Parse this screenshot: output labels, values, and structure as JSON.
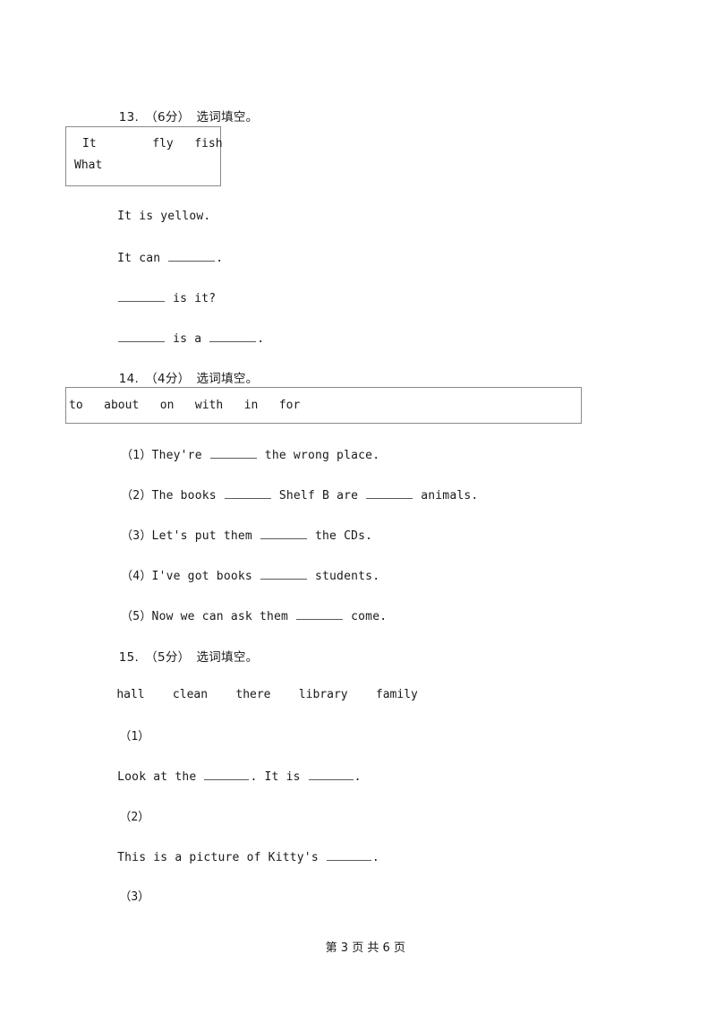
{
  "document": {
    "type": "worksheet",
    "background_color": "#ffffff",
    "text_color": "#1a1a1a",
    "border_color": "#8a8a8a"
  },
  "questions": [
    {
      "number": "13.",
      "points": "（6分）",
      "instruction": "选词填空。",
      "heading": "13.　（6分）　选词填空。",
      "wordbank": {
        "bordered": true,
        "line1": "It        fly   fish",
        "line2": "What"
      },
      "lines": [
        {
          "prefix": "It is yellow.",
          "mid": "",
          "suffix": "",
          "blanks": 0
        },
        {
          "prefix": "It can ",
          "mid": "",
          "suffix": ".",
          "blanks": 1
        },
        {
          "prefix": "",
          "mid": " is it?",
          "suffix": "",
          "blanks": 1
        },
        {
          "prefix": "",
          "mid": " is a ",
          "suffix": ".",
          "blanks": 2
        }
      ]
    },
    {
      "number": "14.",
      "points": "（4分）",
      "instruction": "选词填空。",
      "heading": "14.　（4分）　选词填空。",
      "wordbank": {
        "bordered": true,
        "line1": "to   about   on   with   in   for"
      },
      "items": [
        {
          "label": "（1）",
          "prefix": "They're ",
          "mid": " the wrong place.",
          "suffix": ""
        },
        {
          "label": "（2）",
          "prefix": "The books ",
          "mid": " Shelf B are ",
          "suffix": " animals."
        },
        {
          "label": "（3）",
          "prefix": "Let's put them ",
          "mid": " the CDs.",
          "suffix": ""
        },
        {
          "label": "（4）",
          "prefix": "I've got books ",
          "mid": " students.",
          "suffix": ""
        },
        {
          "label": "（5）",
          "prefix": "Now we can ask them ",
          "mid": " come.",
          "suffix": ""
        }
      ]
    },
    {
      "number": "15.",
      "points": "（5分）",
      "instruction": "选词填空。",
      "heading": "15.　（5分）　选词填空。",
      "wordbank": {
        "bordered": false,
        "line1": "hall    clean    there    library    family"
      },
      "items": [
        {
          "label": "（1）",
          "sentence_prefix": "Look at the ",
          "sentence_mid": ". It is ",
          "sentence_suffix": "."
        },
        {
          "label": "（2）",
          "sentence_prefix": "This is a picture of Kitty's ",
          "sentence_mid": ".",
          "sentence_suffix": ""
        },
        {
          "label": "（3）",
          "sentence_prefix": "",
          "sentence_mid": "",
          "sentence_suffix": ""
        }
      ]
    }
  ],
  "footer": {
    "text": "第 3 页 共 6 页",
    "current_page": "3",
    "total_pages": "6"
  }
}
